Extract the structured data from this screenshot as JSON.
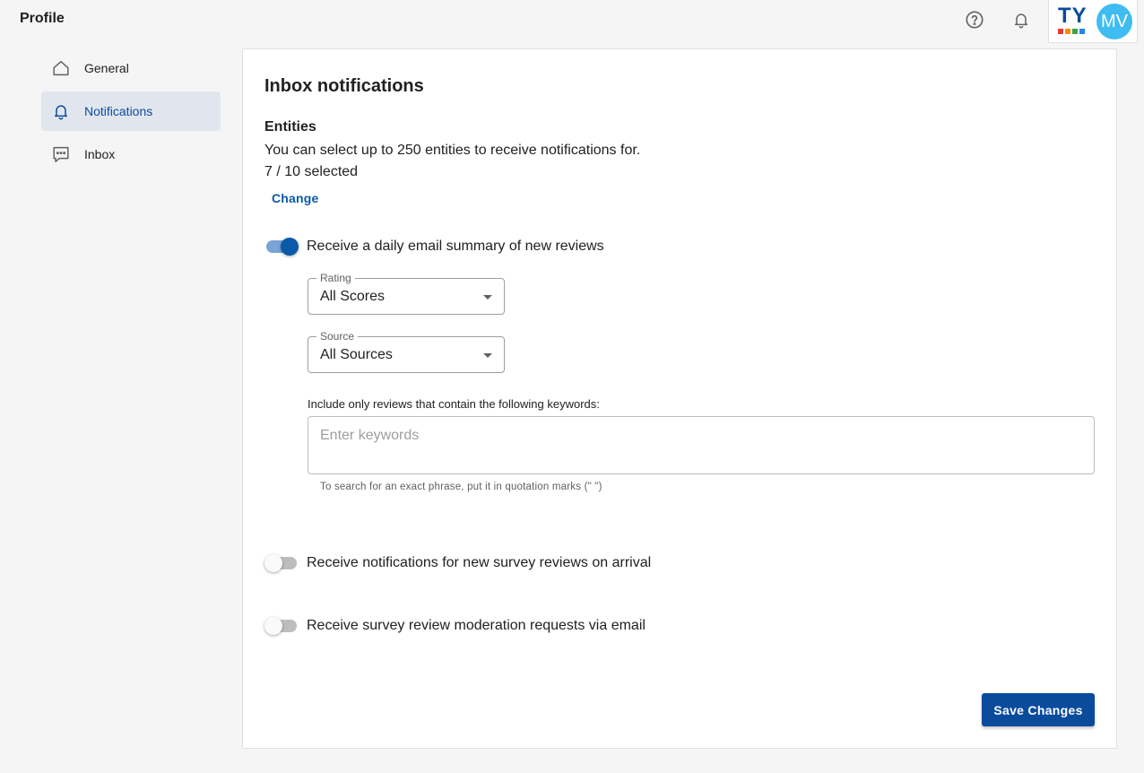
{
  "header": {
    "title": "Profile",
    "help_icon": "help-circle-icon",
    "bell_icon": "bell-icon",
    "brand_logo_text": "TY",
    "brand_colors": [
      "#e53935",
      "#fb8c00",
      "#43a047",
      "#1e88e5"
    ],
    "avatar_initials": "MV",
    "avatar_color": "#3fbcf0"
  },
  "sidebar": {
    "items": [
      {
        "label": "General",
        "icon": "home-icon",
        "active": false
      },
      {
        "label": "Notifications",
        "icon": "bell-icon",
        "active": true
      },
      {
        "label": "Inbox",
        "icon": "chat-bubble-icon",
        "active": false
      }
    ]
  },
  "main": {
    "title": "Inbox notifications",
    "entities": {
      "heading": "Entities",
      "description": "You can select up to 250 entities to receive notifications for.",
      "selected": "7 / 10 selected",
      "change_label": "Change"
    },
    "daily_summary": {
      "label": "Receive a daily email summary of new reviews",
      "enabled": true,
      "rating": {
        "legend": "Rating",
        "value": "All Scores"
      },
      "source": {
        "legend": "Source",
        "value": "All Sources"
      },
      "keywords": {
        "label": "Include only reviews that contain the following keywords:",
        "placeholder": "Enter keywords",
        "value": "",
        "help": "To search for an exact phrase, put it in quotation marks (\" \")"
      }
    },
    "survey_arrival": {
      "label": "Receive notifications for new survey reviews on arrival",
      "enabled": false
    },
    "survey_moderation": {
      "label": "Receive survey review moderation requests via email",
      "enabled": false
    },
    "save_label": "Save Changes"
  },
  "colors": {
    "accent": "#0a4b9c",
    "link": "#0a5aa8",
    "active_nav_bg": "#e1e6ee"
  }
}
